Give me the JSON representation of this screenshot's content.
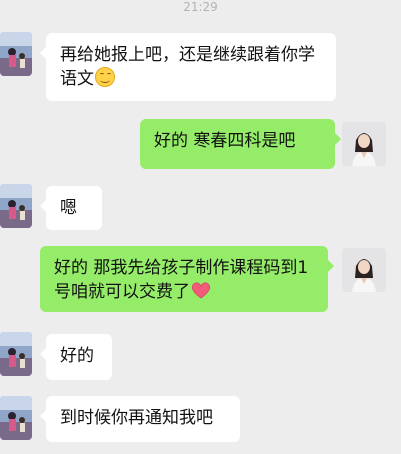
{
  "status": {
    "time": "21:29"
  },
  "messages": [
    {
      "side": "left",
      "text": "再给她报上吧，还是继续跟着你学语文",
      "emoji": "smile-emoji"
    },
    {
      "side": "right",
      "text": "好的  寒春四科是吧"
    },
    {
      "side": "left",
      "text": "嗯"
    },
    {
      "side": "right",
      "text": "好的  那我先给孩子制作课程码到1号咱就可以交费了",
      "emoji": "heart-emoji"
    },
    {
      "side": "left",
      "text": "好的"
    },
    {
      "side": "left",
      "text": "到时候你再通知我吧"
    }
  ],
  "colors": {
    "background": "#ededed",
    "incoming_bubble": "#ffffff",
    "outgoing_bubble": "#95ec69",
    "text": "#111111",
    "timestamp": "#b3b3b3",
    "heart": "#f25c7a"
  }
}
